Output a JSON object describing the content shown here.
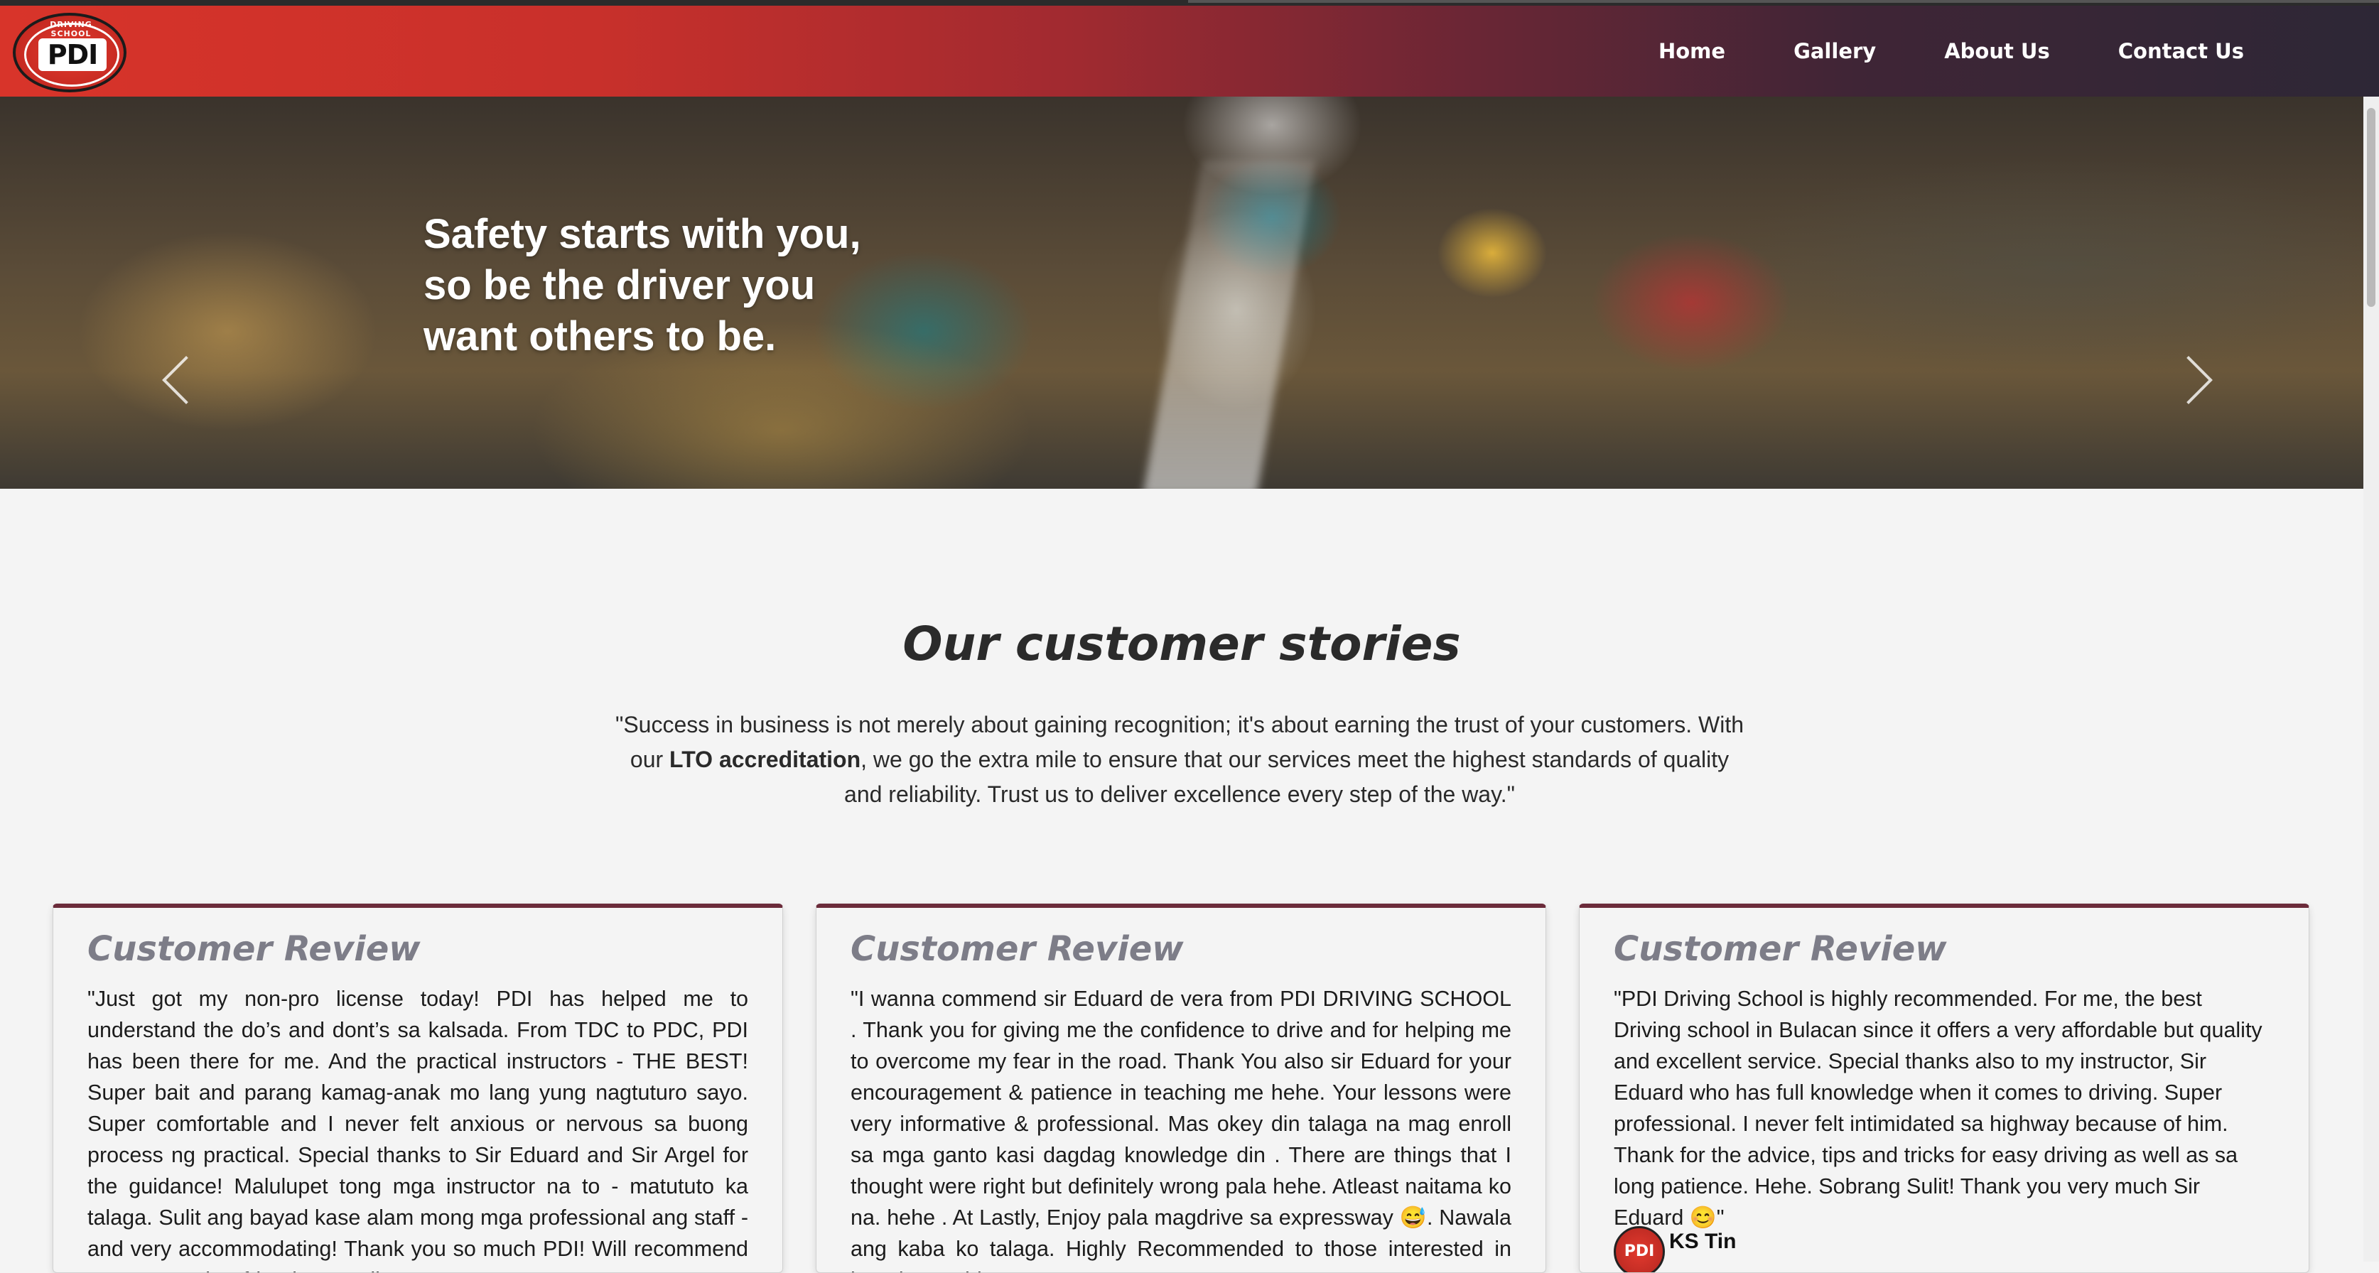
{
  "brand": {
    "logo_text": "PDI",
    "logo_arc_text": "DRIVING SCHOOL"
  },
  "nav": {
    "items": [
      "Home",
      "Gallery",
      "About Us",
      "Contact Us"
    ]
  },
  "hero": {
    "caption_lines": [
      "Safety starts with you,",
      "so be the driver you",
      "want others to be."
    ],
    "slide_count": 5,
    "active_slide": 2
  },
  "stories": {
    "title": "Our customer stories",
    "quote_part1": "\"Success in business is not merely about gaining recognition; it's about earning the trust of your customers. With our ",
    "quote_bold": "LTO accreditation",
    "quote_part2": ", we go the extra mile to ensure that our services meet the highest standards of quality and reliability. Trust us to deliver excellence every step of the way.\""
  },
  "reviews": [
    {
      "heading": "Customer Review",
      "text": "\"Just got my non-pro license today! PDI has helped me to understand the do’s and dont’s sa kalsada. From TDC to PDC, PDI has been there for me. And the practical instructors - THE BEST! Super bait and parang kamag-anak mo lang yung nagtuturo sayo. Super comfortable and I never felt anxious or nervous sa buong process ng practical. Special thanks to Sir Eduard and Sir Argel for the guidance! Malulupet tong mga instructor na to - matututo ka talaga. Sulit ang bayad kase alam mong mga professional ang staff - and very accommodating! Thank you so much PDI! Will recommend you to my other friends as well!\""
    },
    {
      "heading": "Customer Review",
      "text": "\"I wanna commend sir Eduard de vera from PDI DRIVING SCHOOL . Thank you for giving me the confidence to drive and for helping me to overcome my fear in the road. Thank You also sir Eduard for your encouragement & patience in teaching me hehe. Your lessons were very informative & professional. Mas okey din talaga na mag enroll sa mga ganto kasi dagdag knowledge din . There are things that I thought were right but definitely wrong pala hehe. Atleast naitama ko na. hehe . At Lastly, Enjoy pala magdrive sa expressway 😅. Nawala ang kaba ko talaga. Highly Recommended to those interested in learning to drive."
    },
    {
      "heading": "Customer Review",
      "text": "\"PDI Driving School is highly recommended. For me, the best Driving school in Bulacan since it offers a very affordable but quality and excellent service. Special thanks also to my instructor, Sir Eduard who has full knowledge when it comes to driving. Super professional. I never felt intimidated sa highway because of him. Thank for the advice, tips and tricks for easy driving as well as sa long patience. Hehe. Sobrang Sulit! Thank you very much Sir Eduard 😊\"",
      "reviewer_name": "KS Tin"
    }
  ]
}
